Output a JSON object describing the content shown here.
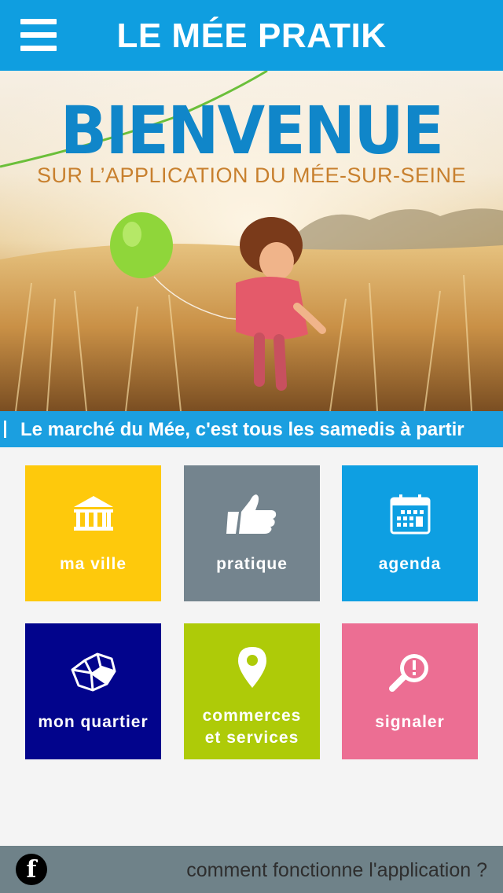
{
  "header": {
    "menu_icon": "hamburger-menu-icon",
    "title": "LE MÉE PRATIK"
  },
  "banner": {
    "title": "BIENVENUE",
    "subtitle": "SUR L’APPLICATION DU MÉE-SUR-SEINE"
  },
  "ticker": {
    "text": "Le marché du Mée, c'est tous les samedis à partir"
  },
  "tiles": [
    {
      "label": "ma ville",
      "icon": "city-hall-icon",
      "color": "#fec90c"
    },
    {
      "label": "pratique",
      "icon": "thumbs-up-icon",
      "color": "#74848e"
    },
    {
      "label": "agenda",
      "icon": "calendar-icon",
      "color": "#0e9fe2"
    },
    {
      "label": "mon quartier",
      "icon": "neighborhood-map-icon",
      "color": "#02048c"
    },
    {
      "label": "commerces et services",
      "label_line1": "commerces",
      "label_line2": "et services",
      "icon": "map-pin-icon",
      "color": "#aecb08"
    },
    {
      "label": "signaler",
      "icon": "report-magnifier-icon",
      "color": "#ec6e93"
    }
  ],
  "footer": {
    "facebook_icon": "f",
    "help_link": "comment fonctionne l'application ?"
  },
  "colors": {
    "header": "#0f9ee0",
    "ticker": "#1b9fe0",
    "footer": "#6f8289"
  }
}
